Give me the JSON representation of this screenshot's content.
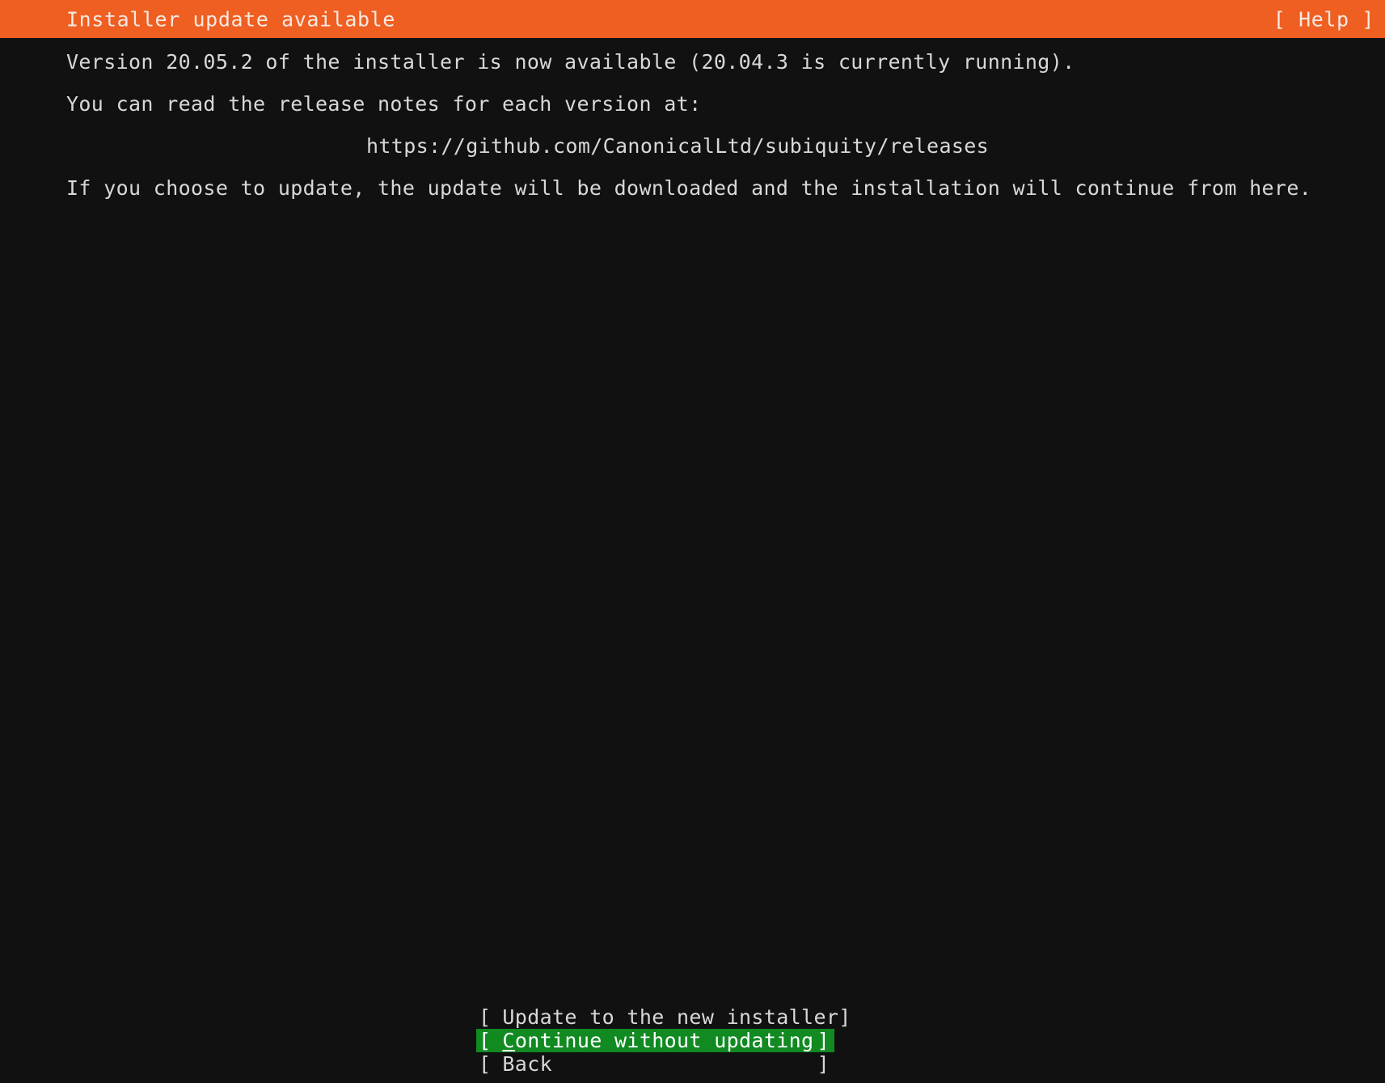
{
  "screen": {
    "title": "Installer update available",
    "background_color": "#111111",
    "header_color": "#ef5f21",
    "text_color": "#d8d8d8",
    "selection_color": "#108a21"
  },
  "header": {
    "title": "Installer update available",
    "help_label": "[ Help ]"
  },
  "body": {
    "version_line": "Version 20.05.2 of the installer is now available (20.04.3 is currently running).",
    "release_notes_line": "You can read the release notes for each version at:",
    "release_notes_url": "https://github.com/CanonicalLtd/subiquity/releases",
    "update_info_line": "If you choose to update, the update will be downloaded and the installation will continue from here.",
    "new_version": "20.05.2",
    "current_version": "20.04.3"
  },
  "buttons": [
    {
      "bracket_left": "[",
      "label": "Update to the new installer",
      "bracket_right": "]",
      "selected": false,
      "accelerator": ""
    },
    {
      "bracket_left": "[",
      "label": "Continue without updating",
      "bracket_right": "]",
      "selected": true,
      "accelerator": "C"
    },
    {
      "bracket_left": "[",
      "label": "Back",
      "bracket_right": "]",
      "selected": false,
      "accelerator": ""
    }
  ]
}
